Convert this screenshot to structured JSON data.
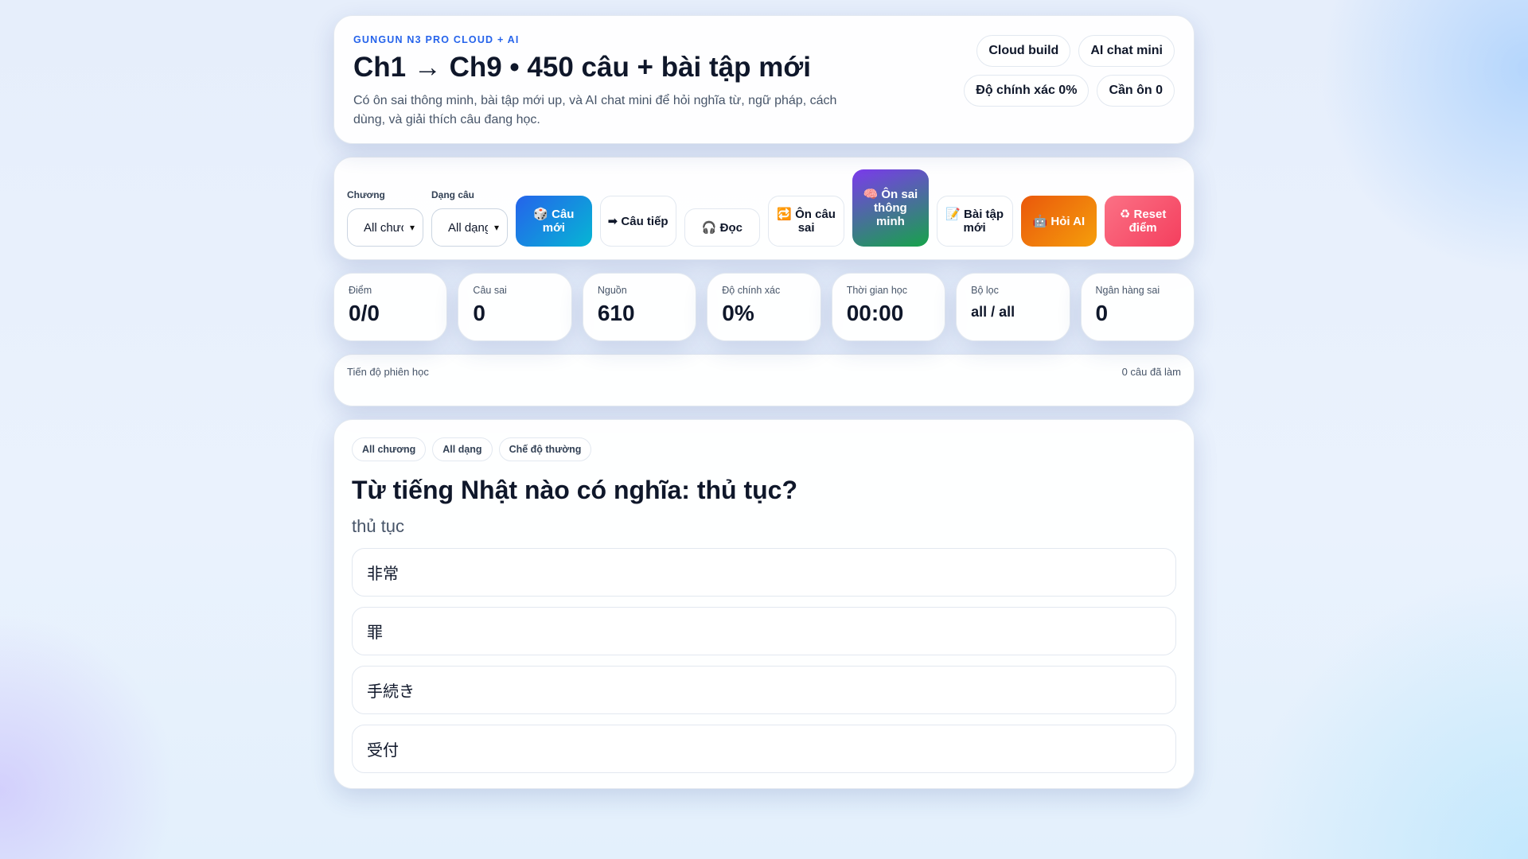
{
  "header": {
    "eyebrow": "GUNGUN N3 PRO CLOUD + AI",
    "title": "Ch1 → Ch9 • 450 câu + bài tập mới",
    "description": "Có ôn sai thông minh, bài tập mới up, và AI chat mini để hỏi nghĩa từ, ngữ pháp, cách dùng, và giải thích câu đang học.",
    "pills": [
      "Cloud build",
      "AI chat mini",
      "Độ chính xác 0%",
      "Cần ôn 0"
    ]
  },
  "toolbar": {
    "chapter_label": "Chương",
    "chapter_value": "All chương",
    "type_label": "Dạng câu",
    "type_value": "All dạng",
    "buttons": [
      {
        "icon": "🎲",
        "label": "Câu mới"
      },
      {
        "icon": "➡",
        "label": "Câu tiếp"
      },
      {
        "icon": "🎧",
        "label": "Đọc"
      },
      {
        "icon": "🔁",
        "label": "Ôn câu sai"
      },
      {
        "icon": "🧠",
        "label": "Ôn sai thông minh"
      },
      {
        "icon": "📝",
        "label": "Bài tập mới"
      },
      {
        "icon": "🤖",
        "label": "Hỏi AI"
      },
      {
        "icon": "♻",
        "label": "Reset điểm"
      }
    ]
  },
  "stats": [
    {
      "label": "Điểm",
      "value": "0/0"
    },
    {
      "label": "Câu sai",
      "value": "0"
    },
    {
      "label": "Nguồn",
      "value": "610"
    },
    {
      "label": "Độ chính xác",
      "value": "0%"
    },
    {
      "label": "Thời gian học",
      "value": "00:00"
    },
    {
      "label": "Bộ lọc",
      "value": "all / all"
    },
    {
      "label": "Ngân hàng sai",
      "value": "0"
    }
  ],
  "progress": {
    "label": "Tiến độ phiên học",
    "count": "0 câu đã làm"
  },
  "question": {
    "tags": [
      "All chương",
      "All dạng",
      "Chế độ thường"
    ],
    "title": "Từ tiếng Nhật nào có nghĩa: thủ tục?",
    "subtitle": "thủ tục",
    "options": [
      "非常",
      "罪",
      "手続き",
      "受付"
    ]
  }
}
